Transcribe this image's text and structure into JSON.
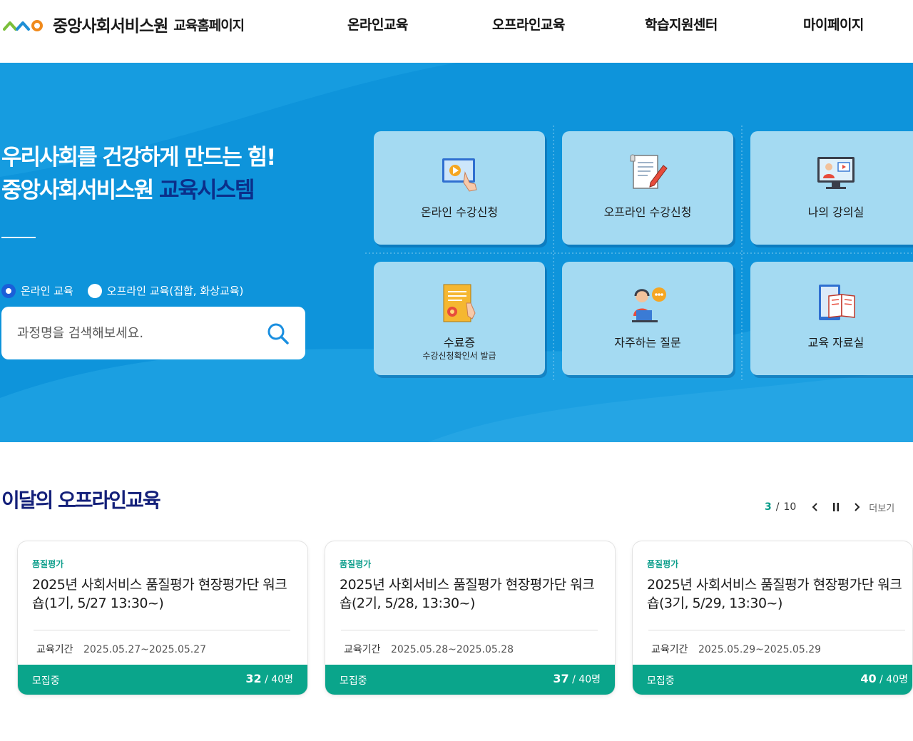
{
  "header": {
    "org_name": "중앙사회서비스원",
    "site_name": "교육홈페이지",
    "nav": [
      "온라인교육",
      "오프라인교육",
      "학습지원센터",
      "마이페이지"
    ]
  },
  "hero": {
    "title_line1": "우리사회를 건강하게 만드는 힘!",
    "title_line2_a": "중앙사회서비스원",
    "title_line2_b": "교육시스템",
    "radio_online": "온라인 교육",
    "radio_offline": "오프라인 교육(집합, 화상교육)",
    "search_placeholder": "과정명을 검색해보세요.",
    "tiles": [
      {
        "label": "온라인 수강신청",
        "icon": "online-video-icon"
      },
      {
        "label": "오프라인 수강신청",
        "icon": "document-pen-icon"
      },
      {
        "label": "나의 강의실",
        "icon": "monitor-lecture-icon"
      },
      {
        "label": "수료증",
        "sub": "수강신청확인서 발급",
        "icon": "certificate-icon"
      },
      {
        "label": "자주하는 질문",
        "icon": "support-chat-icon"
      },
      {
        "label": "교육 자료실",
        "icon": "book-archive-icon"
      }
    ]
  },
  "section": {
    "title": "이달의 오프라인교육",
    "pager_current": "3",
    "pager_total": "10",
    "more": "더보기"
  },
  "cards": [
    {
      "category": "품질평가",
      "title": "2025년 사회서비스 품질평가 현장평가단 워크숍(1기, 5/27 13:30~)",
      "period_label": "교육기간",
      "period": "2025.05.27~2025.05.27",
      "status": "모집중",
      "count": "32",
      "capacity": "40명"
    },
    {
      "category": "품질평가",
      "title": "2025년 사회서비스 품질평가 현장평가단 워크숍(2기, 5/28, 13:30~)",
      "period_label": "교육기간",
      "period": "2025.05.28~2025.05.28",
      "status": "모집중",
      "count": "37",
      "capacity": "40명"
    },
    {
      "category": "품질평가",
      "title": "2025년 사회서비스 품질평가 현장평가단 워크숍(3기, 5/29, 13:30~)",
      "period_label": "교육기간",
      "period": "2025.05.29~2025.05.29",
      "status": "모집중",
      "count": "40",
      "capacity": "40명"
    }
  ],
  "colors": {
    "hero_bg": "#1096dc",
    "tile_bg": "#a4daf2",
    "accent_teal": "#0aa58b",
    "title_navy": "#14207a"
  }
}
